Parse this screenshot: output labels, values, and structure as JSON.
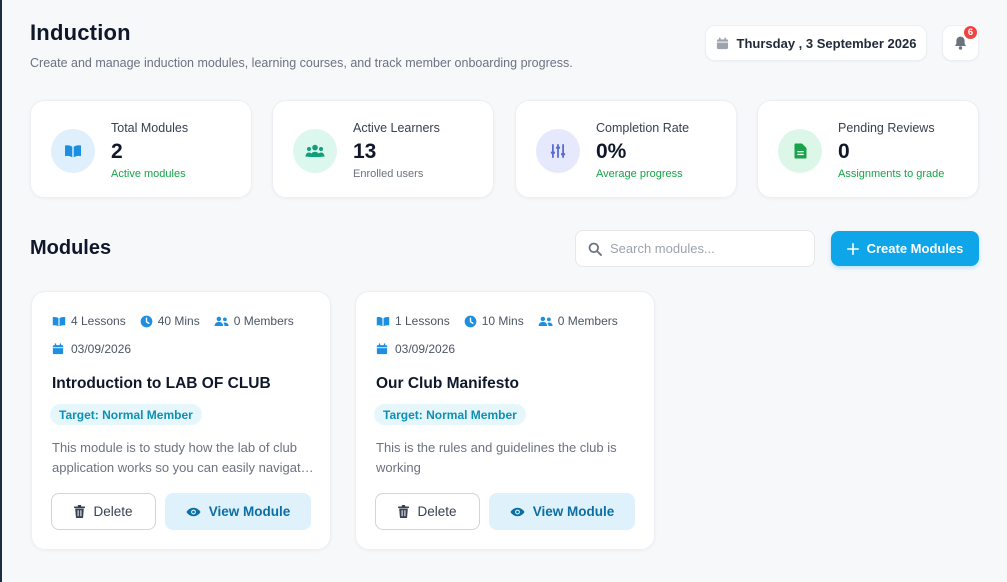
{
  "header": {
    "title": "Induction",
    "subtitle": "Create and manage induction modules, learning courses, and track member onboarding progress.",
    "date": "Thursday , 3 September 2026",
    "notification_count": "6",
    "icons": {
      "date": "calendar-icon",
      "notifications": "bell-icon"
    }
  },
  "stats": [
    {
      "label": "Total Modules",
      "value": "2",
      "sub": "Active modules",
      "icon": "book-open-icon",
      "icon_bg": "#e0effc",
      "icon_color": "#1d8fe0",
      "sub_color": "#16a34a"
    },
    {
      "label": "Active Learners",
      "value": "13",
      "sub": "Enrolled users",
      "icon": "users-icon",
      "icon_bg": "#dcf7ee",
      "icon_color": "#0f9f7a",
      "sub_color": "#6b7280"
    },
    {
      "label": "Completion Rate",
      "value": "0%",
      "sub": "Average progress",
      "icon": "sliders-icon",
      "icon_bg": "#e6e9fb",
      "icon_color": "#5b6bd8",
      "sub_color": "#16a34a"
    },
    {
      "label": "Pending Reviews",
      "value": "0",
      "sub": "Assignments to grade",
      "icon": "file-icon",
      "icon_bg": "#dcf7e8",
      "icon_color": "#16a34a",
      "sub_color": "#16a34a"
    }
  ],
  "modules_section": {
    "title": "Modules",
    "search_placeholder": "Search modules...",
    "search_value": "",
    "create_label": "Create Modules"
  },
  "modules": [
    {
      "lessons": "4 Lessons",
      "duration": "40 Mins",
      "members": "0 Members",
      "date": "03/09/2026",
      "title": "Introduction to LAB OF CLUB",
      "target": "Target: Normal Member",
      "description": "This module is to study how the lab of club application works so you can easily navigate through the app and its features",
      "delete_label": "Delete",
      "view_label": "View Module"
    },
    {
      "lessons": "1 Lessons",
      "duration": "10 Mins",
      "members": "0 Members",
      "date": "03/09/2026",
      "title": "Our Club Manifesto",
      "target": "Target: Normal Member",
      "description": "This is the rules and guidelines the club is working",
      "delete_label": "Delete",
      "view_label": "View Module"
    }
  ],
  "colors": {
    "accent": "#0ea5e9",
    "meta_icon": "#1d8fe0",
    "badge": "#ef4444"
  }
}
